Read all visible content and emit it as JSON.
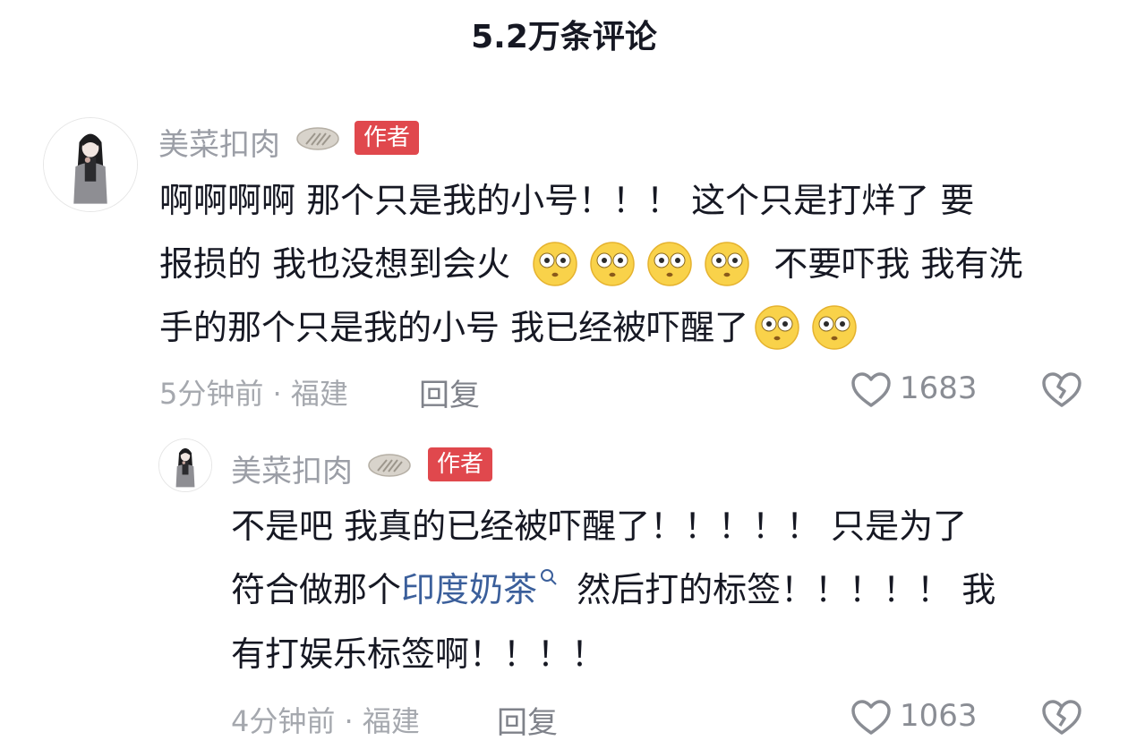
{
  "header": {
    "title": "5.2万条评论"
  },
  "comments": [
    {
      "username": "美菜扣肉",
      "tag": "作者",
      "lines": [
        "啊啊啊啊 那个只是我的小号！！！ 这个只是打烊了 要",
        "报损的 我也没想到会火",
        "不要吓我 我有洗",
        "手的那个只是我的小号 我已经被吓醒了"
      ],
      "time_location": "5分钟前 · 福建",
      "reply_label": "回复",
      "likes": "1683"
    },
    {
      "username": "美菜扣肉",
      "tag": "作者",
      "lines": [
        "不是吧 我真的已经被吓醒了！！！！！ 只是为了",
        "符合做那个",
        "印度奶茶",
        "然后打的标签！！！！！ 我",
        "有打娱乐标签啊！！！！"
      ],
      "time_location": "4分钟前 · 福建",
      "reply_label": "回复",
      "likes": "1063"
    }
  ],
  "colors": {
    "author_tag": "#e0484d",
    "topic_link": "#3b5f9b",
    "meta_text": "#a5a8ae"
  }
}
